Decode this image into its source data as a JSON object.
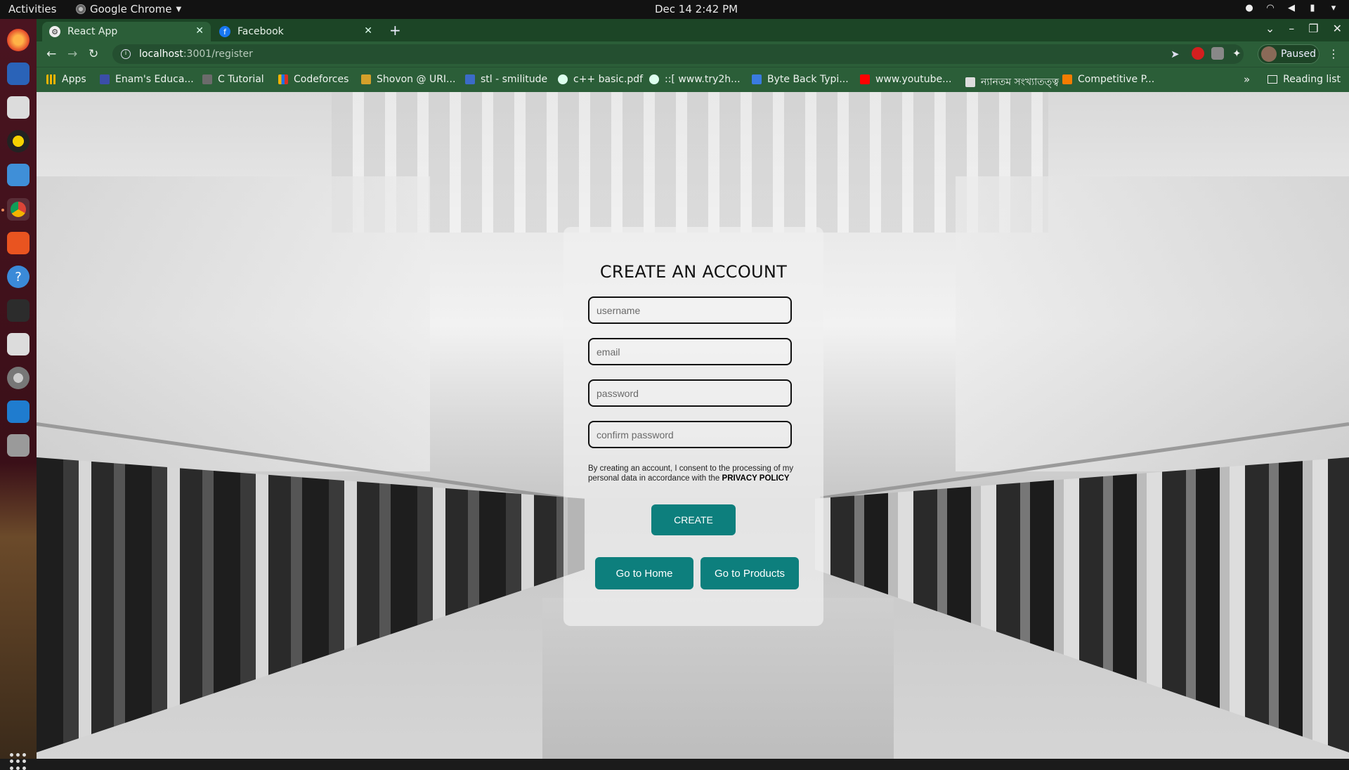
{
  "system": {
    "activities": "Activities",
    "app_menu": "Google Chrome",
    "clock": "Dec 14  2:42 PM"
  },
  "browser": {
    "tabs": [
      {
        "label": "React App",
        "active": true
      },
      {
        "label": "Facebook",
        "active": false
      }
    ],
    "url_host": "localhost",
    "url_path": ":3001/register",
    "profile_status": "Paused",
    "bookmarks": [
      "Apps",
      "Enam's Educa...",
      "C Tutorial",
      "Codeforces",
      "Shovon @ URI...",
      "stl - smilitude",
      "c++ basic.pdf",
      "::[ www.try2h...",
      "Byte Back Typi...",
      "www.youtube...",
      "ন্যানতম সংখ্যাতত্ত্ব",
      "Competitive P..."
    ],
    "reading_list": "Reading list",
    "accent": "#2b5e38"
  },
  "register": {
    "title": "CREATE AN ACCOUNT",
    "username_placeholder": "username",
    "email_placeholder": "email",
    "password_placeholder": "password",
    "confirm_placeholder": "confirm password",
    "consent_text": "By creating an account, I consent to the processing of my personal data in accordance with the",
    "consent_link": "PRIVACY POLICY",
    "create_label": "CREATE",
    "home_label": "Go to Home",
    "products_label": "Go to Products",
    "button_color": "#0d7f7d"
  }
}
